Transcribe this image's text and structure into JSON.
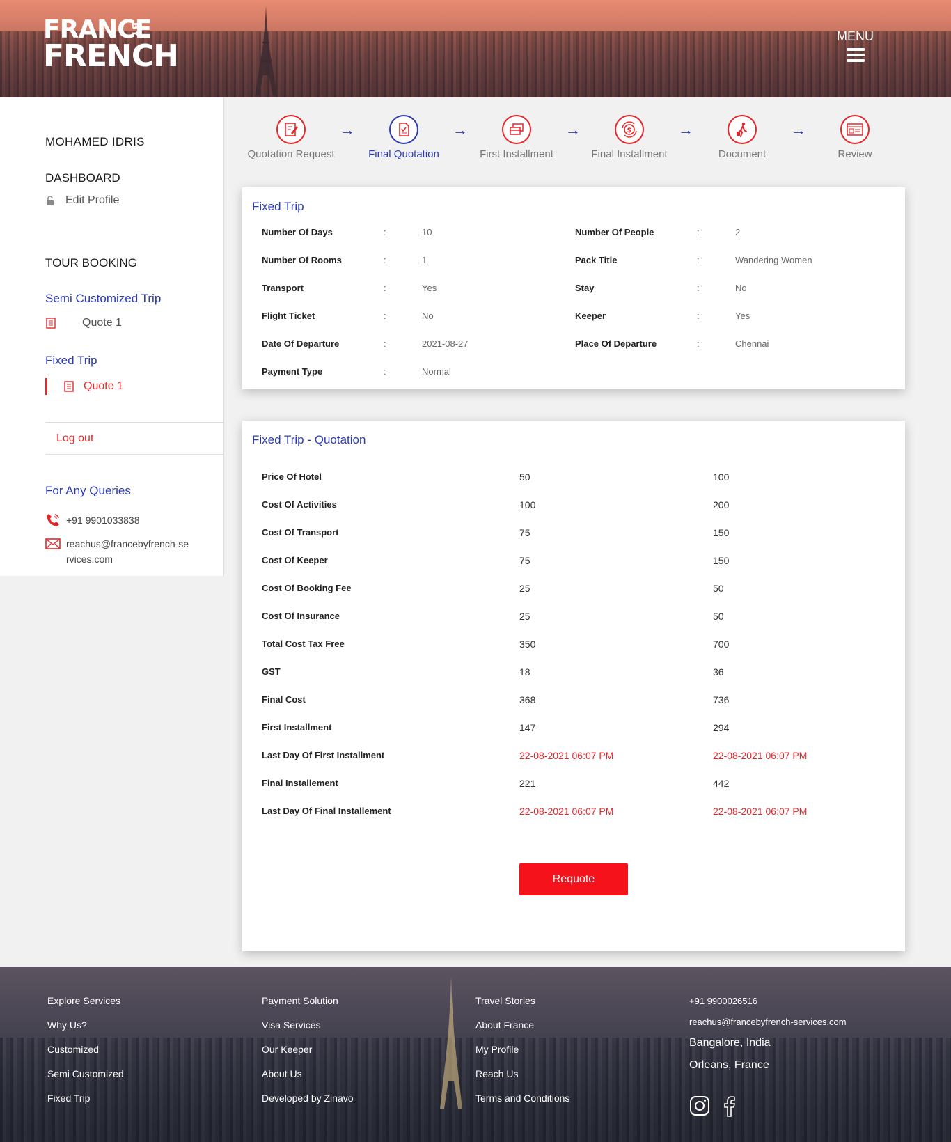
{
  "header": {
    "logo_line1": "FRANCE",
    "logo_by": "BY",
    "logo_line2": "FRENCH",
    "menu_label": "MENU"
  },
  "sidebar": {
    "user_name": "MOHAMED IDRIS",
    "dashboard": "DASHBOARD",
    "edit_profile": "Edit Profile",
    "tour_booking": "TOUR BOOKING",
    "semi_customized": "Semi Customized Trip",
    "semi_quote": "Quote 1",
    "fixed_trip": "Fixed Trip",
    "fixed_quote": "Quote 1",
    "logout": "Log out",
    "queries_title": "For Any Queries",
    "phone": "+91 9901033838",
    "email": "reachus@francebyfrench-services.com"
  },
  "stepper": {
    "steps": [
      {
        "label": "Quotation Request",
        "icon": "pen-paper-icon",
        "active": false
      },
      {
        "label": "Final Quotation",
        "icon": "document-icon",
        "active": true
      },
      {
        "label": "First Installment",
        "icon": "cards-icon",
        "active": false
      },
      {
        "label": "Final Installment",
        "icon": "dollar-cycle-icon",
        "active": false
      },
      {
        "label": "Document",
        "icon": "traveler-icon",
        "active": false
      },
      {
        "label": "Review",
        "icon": "review-icon",
        "active": false
      }
    ],
    "arrow_glyph": "→"
  },
  "fixed_trip": {
    "title": "Fixed Trip",
    "separator": ":",
    "left": [
      {
        "key": "Number Of Days",
        "value": "10"
      },
      {
        "key": "Number Of Rooms",
        "value": "1"
      },
      {
        "key": "Transport",
        "value": "Yes"
      },
      {
        "key": "Flight Ticket",
        "value": "No"
      },
      {
        "key": "Date Of Departure",
        "value": "2021-08-27"
      },
      {
        "key": "Payment Type",
        "value": "Normal"
      }
    ],
    "right": [
      {
        "key": "Number Of People",
        "value": "2"
      },
      {
        "key": "Pack Title",
        "value": "Wandering Women"
      },
      {
        "key": "Stay",
        "value": "No"
      },
      {
        "key": "Keeper",
        "value": "Yes"
      },
      {
        "key": "Place Of Departure",
        "value": "Chennai"
      }
    ]
  },
  "quotation": {
    "title": "Fixed Trip - Quotation",
    "rows": [
      {
        "key": "Price Of Hotel",
        "a": "50",
        "b": "100",
        "highlight": false
      },
      {
        "key": "Cost Of Activities",
        "a": "100",
        "b": "200",
        "highlight": false
      },
      {
        "key": "Cost Of Transport",
        "a": "75",
        "b": "150",
        "highlight": false
      },
      {
        "key": "Cost Of Keeper",
        "a": "75",
        "b": "150",
        "highlight": false
      },
      {
        "key": "Cost Of Booking Fee",
        "a": "25",
        "b": "50",
        "highlight": false
      },
      {
        "key": "Cost Of Insurance",
        "a": "25",
        "b": "50",
        "highlight": false
      },
      {
        "key": "Total Cost Tax Free",
        "a": "350",
        "b": "700",
        "highlight": false
      },
      {
        "key": "GST",
        "a": "18",
        "b": "36",
        "highlight": false
      },
      {
        "key": "Final Cost",
        "a": "368",
        "b": "736",
        "highlight": false
      },
      {
        "key": "First Installment",
        "a": "147",
        "b": "294",
        "highlight": false
      },
      {
        "key": "Last Day Of First Installment",
        "a": "22-08-2021 06:07 PM",
        "b": "22-08-2021 06:07 PM",
        "highlight": true
      },
      {
        "key": "Final Installement",
        "a": "221",
        "b": "442",
        "highlight": false
      },
      {
        "key": "Last Day Of Final Installement",
        "a": "22-08-2021 06:07 PM",
        "b": "22-08-2021 06:07 PM",
        "highlight": true
      }
    ],
    "requote_label": "Requote"
  },
  "footer": {
    "columns": [
      [
        "Explore Services",
        "Why Us?",
        "Customized",
        "Semi Customized",
        "Fixed Trip"
      ],
      [
        "Payment Solution",
        "Visa Services",
        "Our Keeper",
        "About Us",
        "Developed by Zinavo"
      ],
      [
        "Travel Stories",
        "About France",
        "My Profile",
        "Reach Us",
        "Terms and Conditions"
      ]
    ],
    "phone": "+91 9900026516",
    "email": "reachus@francebyfrench-services.com",
    "location1": "Bangalore, India",
    "location2": "Orleans, France",
    "social": [
      "instagram-icon",
      "facebook-icon"
    ]
  },
  "colors": {
    "accent_blue": "#2c3bb5",
    "accent_red": "#e8262a",
    "button_red": "#f5121b"
  }
}
